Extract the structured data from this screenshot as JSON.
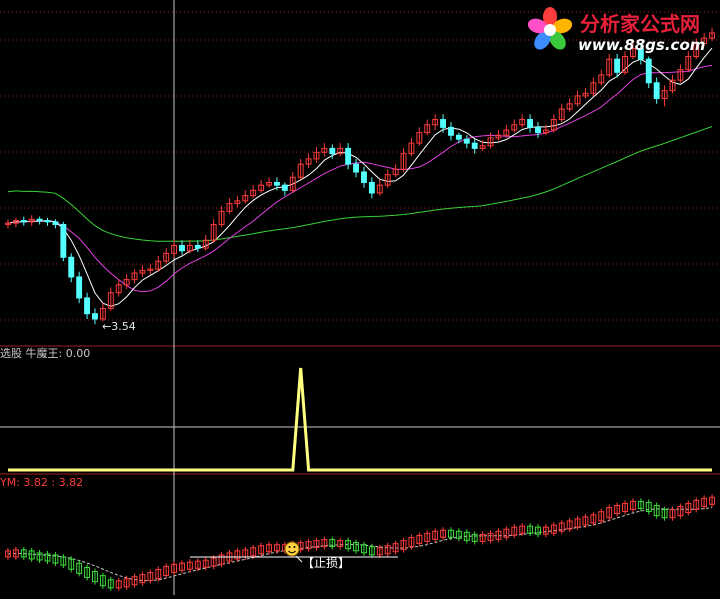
{
  "watermark": {
    "title": "分析家公式网",
    "url": "www.88gs.com",
    "colors": {
      "title": "#e8203a",
      "url": "#ffffff",
      "petals": [
        "#ff3c3c",
        "#ffb400",
        "#3cc83c",
        "#3c8cff",
        "#ff50c8"
      ]
    }
  },
  "colors": {
    "background": "#000000",
    "up_candle": "#ff3c3c",
    "down_candle": "#54ffff",
    "ma_short": "#ffffff",
    "ma_mid": "#e040e0",
    "ma_long": "#36d236",
    "divider": "#a02020",
    "grid": "#a02020",
    "hline": "#c8c8c8",
    "signal": "#ffff80",
    "panel2_label": "#c8c8c8",
    "panel3_label": "#ff3c3c",
    "bottom_up": "#ff3c3c",
    "bottom_down": "#3cdc3c"
  },
  "panel1": {
    "low_annotation": "3.54"
  },
  "panel2": {
    "label": "选股 牛魔王: 0.00"
  },
  "panel3": {
    "label": "YM: 3.82 : 3.82",
    "stop_label": "【止损】",
    "smiley_icon": "smiley-face"
  },
  "chart_data": [
    {
      "type": "candlestick",
      "panel": "price",
      "x": [
        1,
        2,
        3,
        4,
        5,
        6,
        7,
        8,
        9,
        10,
        11,
        12,
        13,
        14,
        15,
        16,
        17,
        18,
        19,
        20,
        21,
        22,
        23,
        24,
        25,
        26,
        27,
        28,
        29,
        30,
        31,
        32,
        33,
        34,
        35,
        36,
        37,
        38,
        39,
        40,
        41,
        42,
        43,
        44,
        45,
        46,
        47,
        48,
        49,
        50,
        51,
        52,
        53,
        54,
        55,
        56,
        57,
        58,
        59,
        60,
        61,
        62,
        63,
        64,
        65,
        66,
        67,
        68,
        69,
        70,
        71,
        72,
        73,
        74,
        75,
        76,
        77,
        78,
        79,
        80,
        81,
        82,
        83,
        84,
        85,
        86,
        87,
        88,
        89,
        90
      ],
      "open": [
        4.3,
        4.31,
        4.33,
        4.32,
        4.34,
        4.33,
        4.32,
        4.3,
        4.05,
        3.9,
        3.74,
        3.62,
        3.58,
        3.66,
        3.78,
        3.84,
        3.88,
        3.93,
        3.95,
        3.96,
        4.02,
        4.08,
        4.14,
        4.1,
        4.14,
        4.12,
        4.18,
        4.3,
        4.4,
        4.46,
        4.48,
        4.52,
        4.56,
        4.6,
        4.62,
        4.6,
        4.56,
        4.66,
        4.76,
        4.8,
        4.85,
        4.88,
        4.84,
        4.88,
        4.76,
        4.7,
        4.62,
        4.54,
        4.6,
        4.68,
        4.72,
        4.84,
        4.92,
        5.0,
        5.06,
        5.1,
        5.04,
        4.98,
        4.95,
        4.92,
        4.88,
        4.9,
        4.96,
        4.98,
        5.02,
        5.06,
        5.1,
        5.04,
        5.0,
        5.02,
        5.1,
        5.18,
        5.22,
        5.28,
        5.3,
        5.38,
        5.44,
        5.56,
        5.46,
        5.58,
        5.64,
        5.56,
        5.38,
        5.26,
        5.32,
        5.4,
        5.48,
        5.58,
        5.68,
        5.72
      ],
      "close": [
        4.31,
        4.33,
        4.32,
        4.34,
        4.33,
        4.32,
        4.3,
        4.05,
        3.9,
        3.74,
        3.62,
        3.58,
        3.66,
        3.78,
        3.84,
        3.88,
        3.93,
        3.95,
        3.96,
        4.02,
        4.08,
        4.14,
        4.1,
        4.14,
        4.12,
        4.18,
        4.3,
        4.4,
        4.46,
        4.48,
        4.52,
        4.56,
        4.6,
        4.62,
        4.6,
        4.56,
        4.66,
        4.76,
        4.8,
        4.85,
        4.88,
        4.84,
        4.88,
        4.76,
        4.7,
        4.62,
        4.54,
        4.6,
        4.68,
        4.72,
        4.84,
        4.92,
        5.0,
        5.06,
        5.1,
        5.04,
        4.98,
        4.95,
        4.92,
        4.88,
        4.9,
        4.96,
        4.98,
        5.02,
        5.06,
        5.1,
        5.04,
        5.0,
        5.02,
        5.1,
        5.18,
        5.22,
        5.28,
        5.3,
        5.38,
        5.44,
        5.56,
        5.46,
        5.58,
        5.64,
        5.56,
        5.38,
        5.26,
        5.32,
        5.4,
        5.48,
        5.58,
        5.68,
        5.72,
        5.76
      ],
      "high": [
        4.34,
        4.35,
        4.36,
        4.37,
        4.36,
        4.35,
        4.34,
        4.32,
        4.08,
        3.94,
        3.78,
        3.66,
        3.7,
        3.82,
        3.88,
        3.92,
        3.96,
        3.99,
        4.0,
        4.06,
        4.12,
        4.18,
        4.18,
        4.18,
        4.18,
        4.22,
        4.34,
        4.44,
        4.5,
        4.52,
        4.56,
        4.6,
        4.64,
        4.66,
        4.66,
        4.62,
        4.7,
        4.8,
        4.84,
        4.89,
        4.92,
        4.91,
        4.92,
        4.92,
        4.8,
        4.74,
        4.66,
        4.64,
        4.72,
        4.76,
        4.88,
        4.96,
        5.04,
        5.1,
        5.14,
        5.14,
        5.08,
        5.0,
        4.98,
        4.95,
        4.94,
        5.0,
        5.02,
        5.06,
        5.1,
        5.14,
        5.14,
        5.08,
        5.06,
        5.14,
        5.22,
        5.26,
        5.32,
        5.34,
        5.42,
        5.48,
        5.6,
        5.6,
        5.62,
        5.68,
        5.68,
        5.58,
        5.42,
        5.36,
        5.44,
        5.52,
        5.62,
        5.72,
        5.76,
        5.8
      ],
      "low": [
        4.27,
        4.28,
        4.29,
        4.29,
        4.3,
        4.29,
        4.27,
        4.02,
        3.86,
        3.7,
        3.58,
        3.54,
        3.56,
        3.64,
        3.75,
        3.81,
        3.85,
        3.9,
        3.92,
        3.94,
        4.0,
        4.05,
        4.07,
        4.08,
        4.09,
        4.1,
        4.16,
        4.28,
        4.38,
        4.43,
        4.46,
        4.5,
        4.54,
        4.58,
        4.56,
        4.52,
        4.54,
        4.64,
        4.73,
        4.77,
        4.82,
        4.8,
        4.82,
        4.72,
        4.66,
        4.58,
        4.5,
        4.52,
        4.58,
        4.66,
        4.7,
        4.82,
        4.9,
        4.98,
        5.02,
        5.0,
        4.94,
        4.92,
        4.88,
        4.84,
        4.86,
        4.88,
        4.94,
        4.96,
        5.0,
        5.04,
        5.0,
        4.96,
        4.98,
        5.0,
        5.08,
        5.16,
        5.2,
        5.26,
        5.28,
        5.36,
        5.42,
        5.42,
        5.44,
        5.56,
        5.52,
        5.34,
        5.22,
        5.2,
        5.3,
        5.38,
        5.46,
        5.56,
        5.66,
        5.7
      ]
    },
    {
      "type": "line",
      "panel": "signal",
      "series": [
        {
          "values": [
            0,
            0,
            0,
            0,
            0,
            0,
            0,
            0,
            0,
            0,
            0,
            0,
            0,
            0,
            0,
            0,
            0,
            0,
            0,
            0,
            0,
            0,
            0,
            0,
            0,
            0,
            0,
            0,
            0,
            0,
            0,
            0,
            0,
            0,
            0,
            0,
            0,
            1,
            0,
            0,
            0,
            0,
            0,
            0,
            0,
            0,
            0,
            0,
            0,
            0,
            0,
            0,
            0,
            0,
            0,
            0,
            0,
            0,
            0,
            0,
            0,
            0,
            0,
            0,
            0,
            0,
            0,
            0,
            0,
            0,
            0,
            0,
            0,
            0,
            0,
            0,
            0,
            0,
            0,
            0,
            0,
            0,
            0,
            0,
            0,
            0,
            0,
            0,
            0,
            0
          ]
        }
      ]
    },
    {
      "type": "candlestick",
      "panel": "YM",
      "values": [
        3.3,
        3.31,
        3.3,
        3.28,
        3.27,
        3.26,
        3.24,
        3.22,
        3.18,
        3.14,
        3.1,
        3.06,
        3.02,
        3.0,
        3.01,
        3.03,
        3.05,
        3.07,
        3.09,
        3.12,
        3.15,
        3.17,
        3.18,
        3.19,
        3.2,
        3.21,
        3.23,
        3.26,
        3.28,
        3.3,
        3.31,
        3.33,
        3.35,
        3.36,
        3.36,
        3.36,
        3.37,
        3.38,
        3.39,
        3.4,
        3.41,
        3.4,
        3.4,
        3.38,
        3.36,
        3.34,
        3.32,
        3.33,
        3.35,
        3.37,
        3.4,
        3.43,
        3.45,
        3.47,
        3.49,
        3.5,
        3.49,
        3.48,
        3.46,
        3.45,
        3.46,
        3.47,
        3.49,
        3.51,
        3.53,
        3.54,
        3.53,
        3.52,
        3.53,
        3.55,
        3.57,
        3.59,
        3.61,
        3.63,
        3.65,
        3.68,
        3.72,
        3.74,
        3.76,
        3.78,
        3.77,
        3.74,
        3.7,
        3.68,
        3.7,
        3.73,
        3.76,
        3.79,
        3.81,
        3.82
      ]
    }
  ]
}
